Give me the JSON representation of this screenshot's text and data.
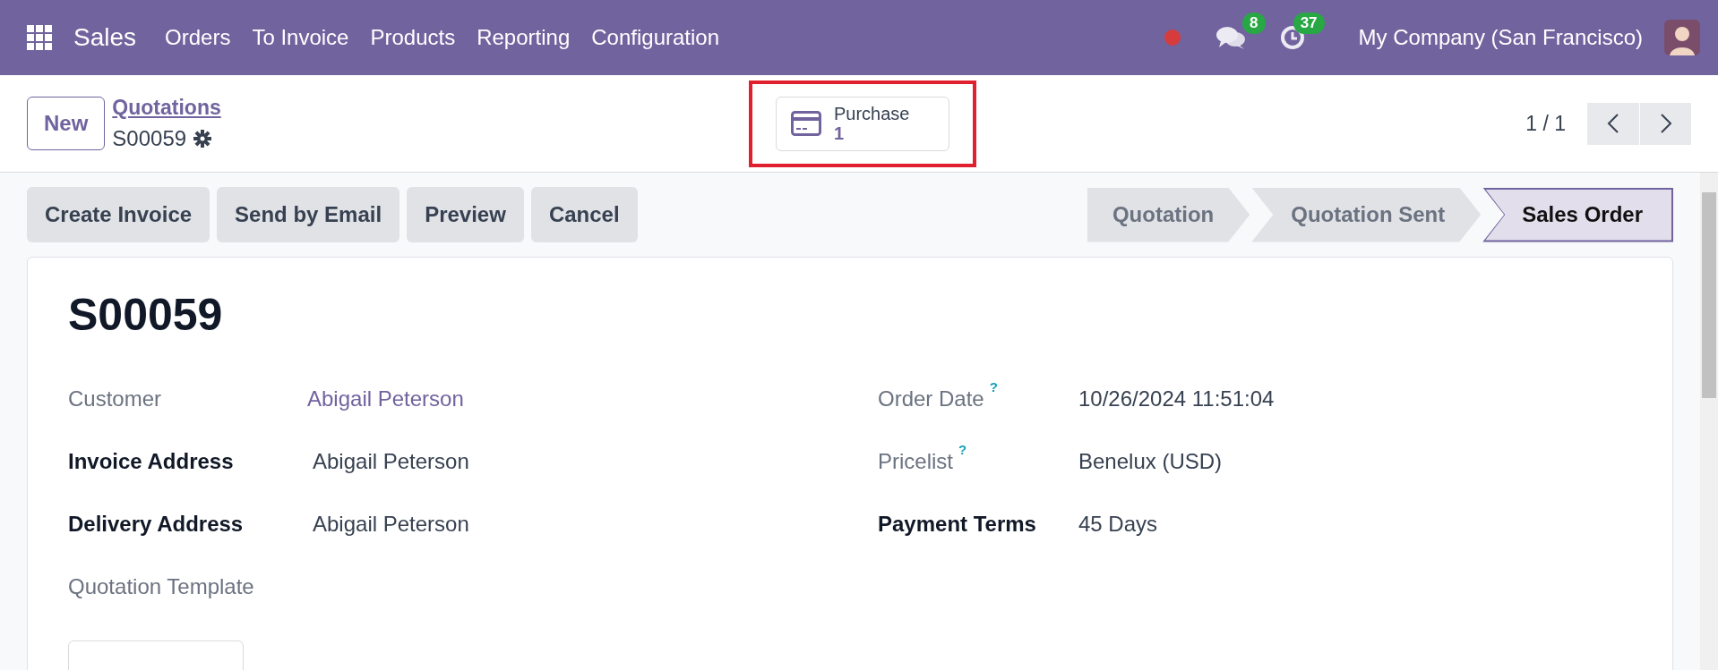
{
  "navbar": {
    "app": "Sales",
    "menu": [
      "Orders",
      "To Invoice",
      "Products",
      "Reporting",
      "Configuration"
    ],
    "messages_badge": "8",
    "activities_badge": "37",
    "company": "My Company (San Francisco)"
  },
  "control_panel": {
    "new_button": "New",
    "breadcrumb": "Quotations",
    "record": "S00059",
    "smart_button": {
      "label": "Purchase",
      "value": "1",
      "highlighted": true
    },
    "pager": "1 / 1"
  },
  "actions": [
    "Create Invoice",
    "Send by Email",
    "Preview",
    "Cancel"
  ],
  "stages": [
    {
      "label": "Quotation",
      "selected": false
    },
    {
      "label": "Quotation Sent",
      "selected": false
    },
    {
      "label": "Sales Order",
      "selected": true
    }
  ],
  "sheet": {
    "title": "S00059",
    "left_fields": [
      {
        "label": "Customer",
        "required": false,
        "value": "Abigail Peterson",
        "kind": "link"
      },
      {
        "label": "Invoice Address",
        "required": true,
        "value": "Abigail Peterson",
        "kind": "text"
      },
      {
        "label": "Delivery Address",
        "required": true,
        "value": "Abigail Peterson",
        "kind": "text"
      },
      {
        "label": "Quotation Template",
        "required": false,
        "kind": "input"
      }
    ],
    "right_fields": [
      {
        "label": "Order Date",
        "required": false,
        "help": "?",
        "value": "10/26/2024 11:51:04",
        "kind": "text"
      },
      {
        "label": "Pricelist",
        "required": false,
        "help": "?",
        "value": "Benelux (USD)",
        "kind": "text"
      },
      {
        "label": "Payment Terms",
        "required": true,
        "value": "45 Days",
        "kind": "text"
      }
    ]
  }
}
